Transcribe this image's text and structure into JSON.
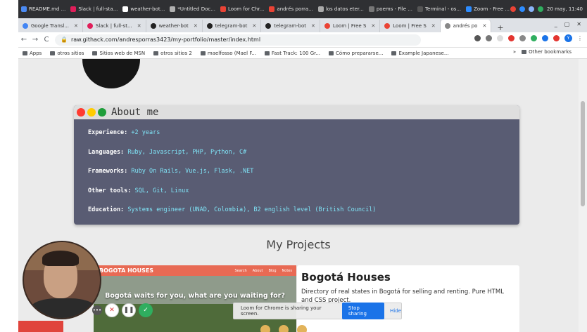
{
  "os_bar": {
    "tasks": [
      {
        "label": "README.md ...",
        "color": "#4b8bf4"
      },
      {
        "label": "Slack | full-sta...",
        "color": "#e01e5a"
      },
      {
        "label": "weather-bot...",
        "color": "#ffffff"
      },
      {
        "label": "*Untitled Doc...",
        "color": "#b0b0b0"
      },
      {
        "label": "Loom for Chr...",
        "color": "#ea4335"
      },
      {
        "label": "andrés porra...",
        "color": "#ea4335"
      },
      {
        "label": "los datos eter...",
        "color": "#aaaaaa"
      },
      {
        "label": "poems - File ...",
        "color": "#777777"
      },
      {
        "label": "Terminal - os...",
        "color": "#555555"
      },
      {
        "label": "Zoom - Free ...",
        "color": "#2d8cff"
      }
    ],
    "clock": "20 may, 11:40"
  },
  "tabs": [
    {
      "label": "Google Transl...",
      "color": "#4285f4"
    },
    {
      "label": "Slack | full-st...",
      "color": "#e01e5a"
    },
    {
      "label": "weather-bot",
      "color": "#222222"
    },
    {
      "label": "telegram-bot",
      "color": "#222222"
    },
    {
      "label": "telegram-bot",
      "color": "#222222"
    },
    {
      "label": "Loom | Free S",
      "color": "#ea4335"
    },
    {
      "label": "Loom | Free S",
      "color": "#ea4335"
    },
    {
      "label": "andrés po",
      "color": "#888888",
      "active": true
    }
  ],
  "address": {
    "url": "raw.githack.com/andresporras3423/my-portfolio/master/index.html"
  },
  "bookmarks": {
    "items": [
      "Apps",
      "otros sitios",
      "Sitios web de MSN",
      "otros sitios 2",
      "maelfosso (Mael F...",
      "Fast Track: 100 Gr...",
      "Cómo prepararse...",
      "Example Japanese..."
    ],
    "more": "»",
    "other": "Other bookmarks"
  },
  "about": {
    "title": "About me",
    "rows": [
      {
        "key": "Experience:",
        "value": "+2 years"
      },
      {
        "key": "Languages:",
        "value": "Ruby, Javascript, PHP, Python, C#"
      },
      {
        "key": "Frameworks:",
        "value": "Ruby On Rails, Vue.js, Flask, .NET"
      },
      {
        "key": "Other tools:",
        "value": "SQL, Git, Linux"
      },
      {
        "key": "Education:",
        "value": "Systems engineer (UNAD, Colombia), B2 english level (British Council)"
      }
    ]
  },
  "projects": {
    "heading": "My Projects",
    "items": [
      {
        "banner": "BOGOTA HOUSES",
        "links": [
          "Search",
          "About",
          "Blog",
          "Notes"
        ],
        "headline": "Bogotá waits for you, what are you waiting for?",
        "title": "Bogotá Houses",
        "description": "Directory of real states in Bogotá for selling and renting. Pure HTML and CSS project."
      }
    ]
  },
  "loom": {
    "share_text": "Loom for Chrome is sharing your screen.",
    "stop_label": "Stop sharing",
    "hide_label": "Hide"
  }
}
